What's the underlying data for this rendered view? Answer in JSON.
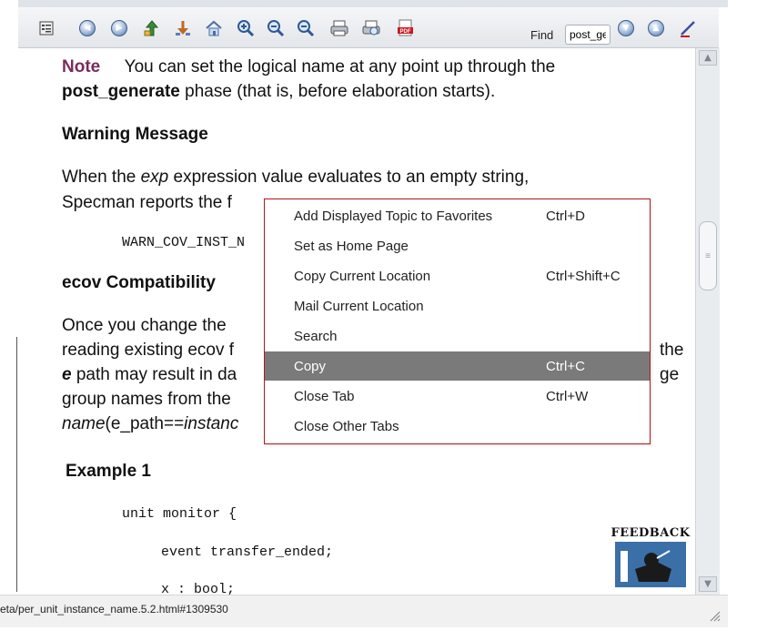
{
  "toolbar": {
    "find_label": "Find",
    "find_value": "post_ge",
    "buttons": [
      {
        "icon": "sync-toc-icon"
      },
      {
        "icon": "back-icon"
      },
      {
        "icon": "forward-icon"
      },
      {
        "icon": "up-level-icon"
      },
      {
        "icon": "bookmarks-icon"
      },
      {
        "icon": "home-icon"
      },
      {
        "icon": "zoom-in-icon"
      },
      {
        "icon": "zoom-out-icon"
      },
      {
        "icon": "zoom-reset-icon"
      },
      {
        "icon": "print-icon"
      },
      {
        "icon": "print-preview-icon"
      },
      {
        "icon": "pdf-icon"
      },
      {
        "icon": "find-next-icon"
      },
      {
        "icon": "find-previous-icon"
      },
      {
        "icon": "highlight-icon"
      }
    ]
  },
  "content": {
    "note_label": "Note",
    "note_line1": "You can set the logical name at any point up through the",
    "note_line2_bold": "post_generate",
    "note_line2_rest": " phase (that is, before elaboration starts).",
    "warning_heading": "Warning Message",
    "warning_line1_a": "When the ",
    "warning_line1_em": "exp",
    "warning_line1_b": " expression value evaluates to an empty string,",
    "warning_line2": "Specman reports the f",
    "warning_code": "WARN_COV_INST_N",
    "ecov_heading": "ecov Compatibility",
    "ecov_line1": "Once you change the",
    "ecov_line2_a": "reading existing ecov f",
    "ecov_line2_b": "the",
    "ecov_line3_em": "e",
    "ecov_line3_a": " path may result in da",
    "ecov_line3_b": "ge",
    "ecov_line4": "group names from the",
    "ecov_line5_em": "name",
    "ecov_line5_a": "(e_path==",
    "ecov_line5_em2": "instanc",
    "example_heading": "Example 1",
    "code_line1": "unit monitor {",
    "code_line2": "event transfer_ended;",
    "code_line3": "x : bool;"
  },
  "context_menu": {
    "items": [
      {
        "label": "Add Displayed Topic to Favorites",
        "shortcut": "Ctrl+D"
      },
      {
        "label": "Set as Home Page",
        "shortcut": ""
      },
      {
        "label": "Copy Current Location",
        "shortcut": "Ctrl+Shift+C"
      },
      {
        "label": "Mail Current Location",
        "shortcut": ""
      },
      {
        "label": "Search",
        "shortcut": ""
      },
      {
        "label": "Copy",
        "shortcut": "Ctrl+C",
        "highlighted": true
      },
      {
        "label": "Close Tab",
        "shortcut": "Ctrl+W"
      },
      {
        "label": "Close Other Tabs",
        "shortcut": ""
      }
    ]
  },
  "feedback": {
    "label": "FEEDBACK",
    "icon": "feedback-icon"
  },
  "status": {
    "url": "eta/per_unit_instance_name.5.2.html#1309530"
  },
  "colors": {
    "menu_border": "#b01818",
    "menu_highlight": "#7a7a7a",
    "note_label": "#7b2a5e"
  }
}
